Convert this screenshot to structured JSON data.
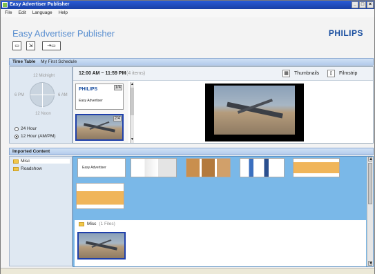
{
  "window": {
    "title": "Easy Advertiser Publisher",
    "controls": [
      "_",
      "□",
      "×"
    ]
  },
  "menu": [
    "File",
    "Edit",
    "Language",
    "Help"
  ],
  "header": {
    "app_title": "Easy Advertiser Publisher",
    "brand": "PHILIPS"
  },
  "toolbar": {
    "btn1_icon": "open-folder-icon",
    "btn2_icon": "save-icon",
    "btn3_icon": "publish-icon"
  },
  "timetable": {
    "label": "Time Table",
    "schedule_name": "My First Schedule",
    "clock": {
      "top": "12 Midnight",
      "left": "6 PM",
      "right": "6 AM",
      "bottom": "12 Noon"
    },
    "format_options": [
      {
        "label": "24 Hour",
        "selected": false
      },
      {
        "label": "12 Hour (AM/PM)",
        "selected": true
      }
    ],
    "range": "12:00 AM ~ 11:59 PM",
    "item_count": "(4 items)",
    "view_thumbnails": "Thumbnails",
    "view_filmstrip": "Filmstrip",
    "slides": [
      {
        "badge": "1/4",
        "brand": "PHILIPS",
        "caption": "Easy Advertiser"
      },
      {
        "badge": "2/4"
      }
    ]
  },
  "imported": {
    "label": "Imported Content",
    "folders": [
      "Misc",
      "Roadshow"
    ],
    "group_title": "Misc",
    "group_count": "(1 Files)",
    "slide_caption": "Easy Advertiser"
  }
}
